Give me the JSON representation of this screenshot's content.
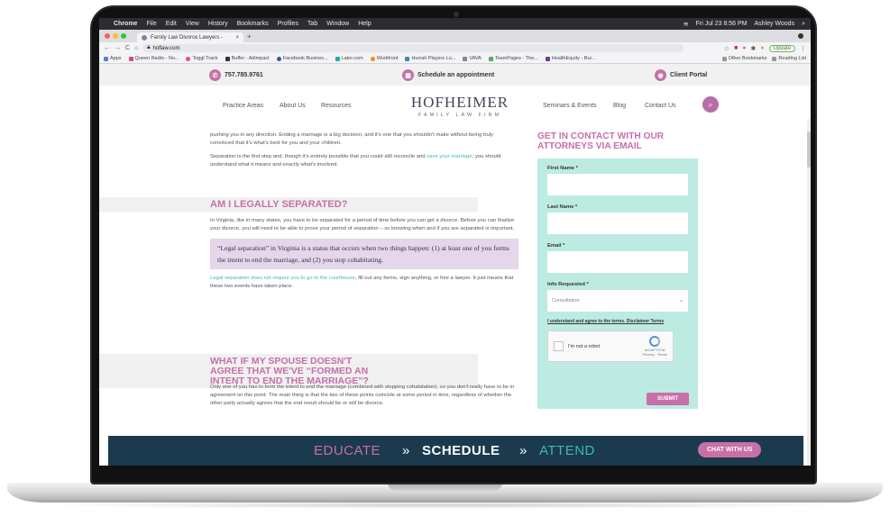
{
  "menubar": {
    "apple": "",
    "app": "Chrome",
    "items": [
      "File",
      "Edit",
      "View",
      "History",
      "Bookmarks",
      "Profiles",
      "Tab",
      "Window",
      "Help"
    ],
    "datetime": "Fri Jul 23 8:56 PM",
    "user": "Ashley Woods"
  },
  "tab": {
    "title": "Family Law Divorce Lawyers -",
    "close": "×",
    "new": "+"
  },
  "address": {
    "url": "hoflaw.com",
    "update": "Update"
  },
  "bookmarks": {
    "items": [
      "Apps",
      "Queen Radio - No...",
      "Toggl Track",
      "Buffer - Adimpact",
      "Facebook Busines...",
      "Later.com",
      "Workfront",
      "Hurrah Players Lo...",
      "VAVA",
      "TeamPages - The...",
      "HealthEquity - Bui..."
    ],
    "right": [
      "Other Bookmarks",
      "Reading List"
    ]
  },
  "topstrip": {
    "phone": "757.785.9761",
    "schedule": "Schedule an appointment",
    "portal": "Client Portal"
  },
  "nav": {
    "left": [
      "Practice Areas",
      "About Us",
      "Resources"
    ],
    "right": [
      "Seminars & Events",
      "Blog",
      "Contact Us"
    ]
  },
  "logo": {
    "line1": "HOFHEIMER",
    "line2": "FAMILY LAW FIRM"
  },
  "article": {
    "p1": "pushing you in any direction. Ending a marriage is a big decision, and it's one that you shouldn't make without being truly convinced that it's what's best for you and your children.",
    "p2a": "Separation is the first step and, though it's entirely possible that you could still reconcile and ",
    "p2link": "save your marriage",
    "p2b": ", you should understand what it means and exactly what's involved.",
    "h1": "AM I LEGALLY SEPARATED?",
    "p3": "In Virginia, like in many states, you have to be separated for a period of time before you can get a divorce.  Before you can finalize your divorce, you will need to be able to prove your period of separation – so knowing when and if you are separated is important.",
    "quote": "“Legal separation” in Virginia is a status that occurs when two things happen: (1) at least one of you forms the intent to end the marriage, and (2) you stop cohabitating.",
    "p4link": "Legal separation does not require you to go to the courthouse",
    "p4b": ", fill out any forms, sign anything, or hire a lawyer. It just means that these two events have taken place.",
    "h2": "WHAT IF MY SPOUSE DOESN'T AGREE THAT WE'VE “FORMED AN INTENT TO END THE MARRIAGE”?",
    "p5": "Only one of you has to form the intent to end the marriage (combined with stopping cohabitation), so you don't really have to be in agreement on this point. The main thing is that the two of these points coincide at some period in time, regardless of whether the other party actually agrees that the end result should be or will be divorce."
  },
  "sidebar": {
    "heading": "GET IN CONTACT WITH OUR ATTORNEYS VIA EMAIL",
    "first": "First Name *",
    "last": "Last Name *",
    "email": "Email *",
    "info": "Info Requested *",
    "info_value": "Consultation",
    "terms": "I understand and agree to the terms. Disclaimer Terms",
    "captcha": "I'm not a robot",
    "rc": "reCAPTCHA",
    "rc2": "Privacy - Terms",
    "submit": "SUBMIT"
  },
  "cta": {
    "educate": "EDUCATE",
    "sep1": "»",
    "schedule": "SCHEDULE",
    "sep2": "»",
    "attend": "ATTEND",
    "chat": "CHAT WITH US"
  },
  "colors": {
    "brand_pink": "#c770a8",
    "teal": "#3fb9b3",
    "navy": "#1b3a4e",
    "form_bg": "#bdebe2",
    "quote_bg": "#e5d6eb"
  }
}
